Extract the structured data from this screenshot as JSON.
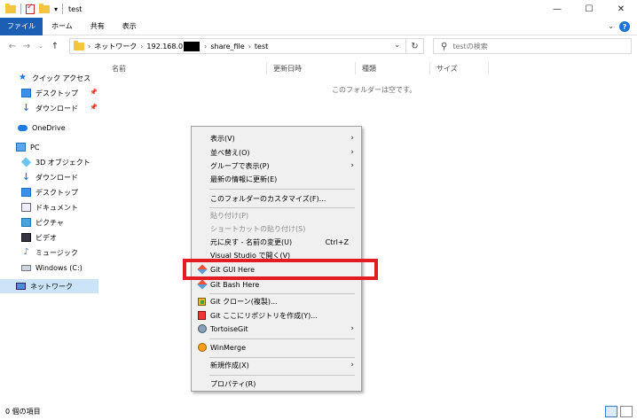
{
  "window": {
    "title": "test"
  },
  "ribbon": {
    "tabs": [
      "ファイル",
      "ホーム",
      "共有",
      "表示"
    ]
  },
  "address": {
    "crumbs": [
      "ネットワーク",
      "192.168.0",
      "share_file",
      "test"
    ],
    "search_placeholder": "testの検索"
  },
  "sidebar": {
    "quick_access": "クイック アクセス",
    "desktop": "デスクトップ",
    "downloads": "ダウンロード",
    "onedrive": "OneDrive",
    "pc": "PC",
    "objects3d": "3D オブジェクト",
    "downloads2": "ダウンロード",
    "desktop2": "デスクトップ",
    "documents": "ドキュメント",
    "pictures": "ピクチャ",
    "videos": "ビデオ",
    "music": "ミュージック",
    "windows_c": "Windows (C:)",
    "network": "ネットワーク"
  },
  "columns": [
    "名前",
    "更新日時",
    "種類",
    "サイズ"
  ],
  "empty_message": "このフォルダーは空です。",
  "context_menu": {
    "view": "表示(V)",
    "sort": "並べ替え(O)",
    "group": "グループで表示(P)",
    "refresh": "最新の情報に更新(E)",
    "customize": "このフォルダーのカスタマイズ(F)...",
    "paste": "貼り付け(P)",
    "paste_shortcut": "ショートカットの貼り付け(S)",
    "undo": "元に戻す - 名前の変更(U)",
    "undo_shortcut": "Ctrl+Z",
    "vs": "Visual Studio で開く(V)",
    "git_gui": "Git GUI Here",
    "git_bash": "Git Bash Here",
    "git_clone": "Git クローン(複製)...",
    "git_create": "Git ここにリポジトリを作成(Y)...",
    "tortoise": "TortoiseGit",
    "winmerge": "WinMerge",
    "new": "新規作成(X)",
    "properties": "プロパティ(R)"
  },
  "status": {
    "items": "0 個の項目"
  }
}
